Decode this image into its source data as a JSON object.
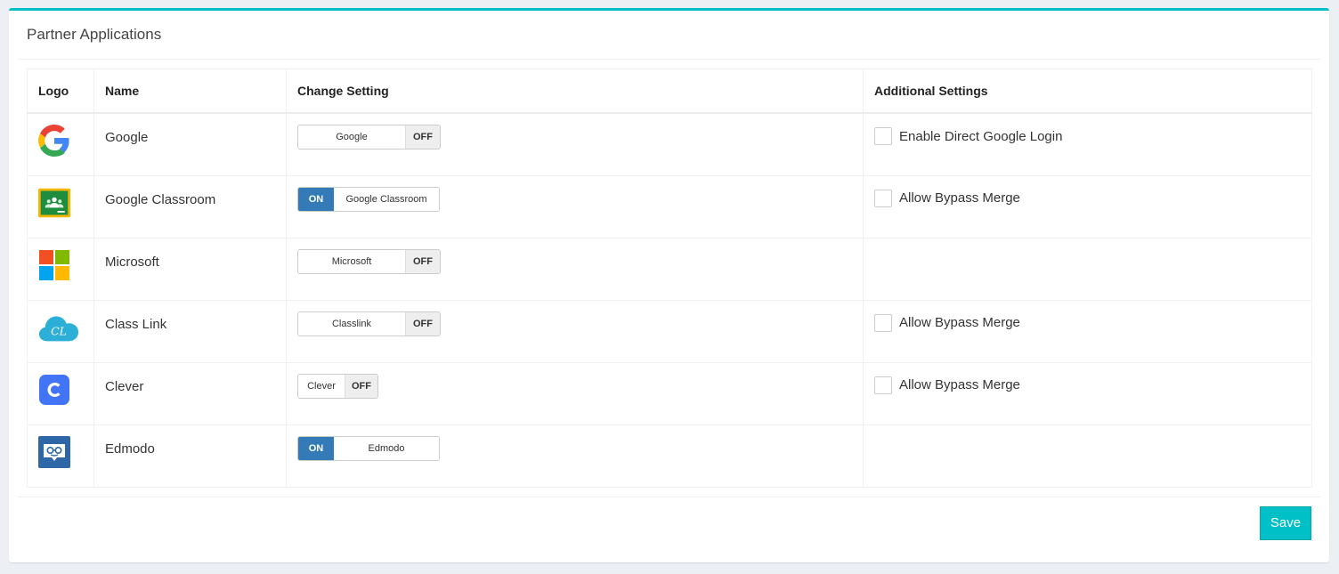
{
  "panel": {
    "title": "Partner Applications"
  },
  "table": {
    "headers": {
      "logo": "Logo",
      "name": "Name",
      "change_setting": "Change Setting",
      "additional_settings": "Additional Settings"
    },
    "rows": [
      {
        "name": "Google",
        "toggle_label": "Google",
        "state": "OFF",
        "additional": "Enable Direct Google Login",
        "logo_icon": "google-logo-icon"
      },
      {
        "name": "Google Classroom",
        "toggle_label": "Google Classroom",
        "state": "ON",
        "additional": "Allow Bypass Merge",
        "logo_icon": "google-classroom-logo-icon"
      },
      {
        "name": "Microsoft",
        "toggle_label": "Microsoft",
        "state": "OFF",
        "additional": "",
        "logo_icon": "microsoft-logo-icon"
      },
      {
        "name": "Class Link",
        "toggle_label": "Classlink",
        "state": "OFF",
        "additional": "Allow Bypass Merge",
        "logo_icon": "classlink-logo-icon"
      },
      {
        "name": "Clever",
        "toggle_label": "Clever",
        "state": "OFF",
        "additional": "Allow Bypass Merge",
        "logo_icon": "clever-logo-icon"
      },
      {
        "name": "Edmodo",
        "toggle_label": "Edmodo",
        "state": "ON",
        "additional": "",
        "logo_icon": "edmodo-logo-icon"
      }
    ]
  },
  "footer": {
    "save_label": "Save"
  },
  "colors": {
    "accent": "#00c0c7",
    "on": "#337ab7"
  }
}
